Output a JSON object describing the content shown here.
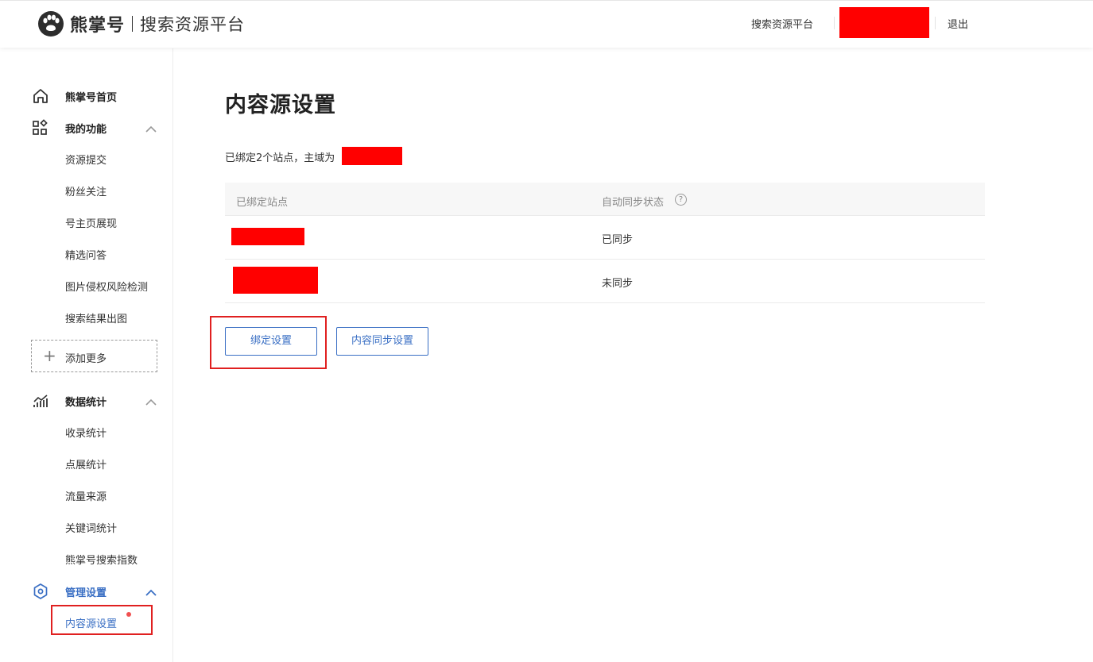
{
  "header": {
    "brand": "熊掌号",
    "subtitle": "搜索资源平台",
    "platform_link": "搜索资源平台",
    "logout": "退出"
  },
  "sidebar": {
    "home": "熊掌号首页",
    "my_functions": {
      "label": "我的功能",
      "items": [
        "资源提交",
        "粉丝关注",
        "号主页展现",
        "精选问答",
        "图片侵权风险检测",
        "搜索结果出图"
      ]
    },
    "add_more": "添加更多",
    "data_stats": {
      "label": "数据统计",
      "items": [
        "收录统计",
        "点展统计",
        "流量来源",
        "关键词统计",
        "熊掌号搜索指数"
      ]
    },
    "management": {
      "label": "管理设置",
      "items": [
        "内容源设置"
      ]
    }
  },
  "main": {
    "title": "内容源设置",
    "summary": "已绑定2个站点，主域为",
    "table": {
      "columns": [
        "已绑定站点",
        "自动同步状态"
      ],
      "help_icon": "?",
      "rows": [
        {
          "status": "已同步"
        },
        {
          "status": "未同步"
        }
      ]
    },
    "buttons": {
      "bind": "绑定设置",
      "sync": "内容同步设置"
    }
  },
  "colors": {
    "accent": "#3a6fc4",
    "redaction": "#ff0000",
    "highlight_border": "#e02020"
  }
}
